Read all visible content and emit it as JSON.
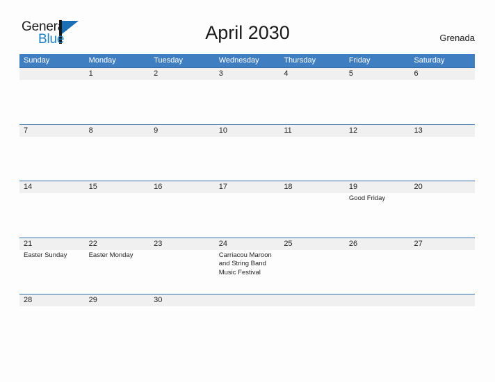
{
  "brand": {
    "name_part1": "General",
    "name_part2": "Blue",
    "mark": "flag-triangle-icon",
    "accent_color": "#1d7fc4"
  },
  "header": {
    "title": "April 2030",
    "location": "Grenada"
  },
  "colors": {
    "header_blue": "#3f7fc1",
    "row_line_blue": "#2f6ca8",
    "band_gray": "#f0f0f0",
    "page_bg": "#fdfdfd",
    "text": "#232323"
  },
  "calendar": {
    "weekdays": [
      "Sunday",
      "Monday",
      "Tuesday",
      "Wednesday",
      "Thursday",
      "Friday",
      "Saturday"
    ],
    "weeks": [
      [
        {
          "date": "",
          "event": ""
        },
        {
          "date": "1",
          "event": ""
        },
        {
          "date": "2",
          "event": ""
        },
        {
          "date": "3",
          "event": ""
        },
        {
          "date": "4",
          "event": ""
        },
        {
          "date": "5",
          "event": ""
        },
        {
          "date": "6",
          "event": ""
        }
      ],
      [
        {
          "date": "7",
          "event": ""
        },
        {
          "date": "8",
          "event": ""
        },
        {
          "date": "9",
          "event": ""
        },
        {
          "date": "10",
          "event": ""
        },
        {
          "date": "11",
          "event": ""
        },
        {
          "date": "12",
          "event": ""
        },
        {
          "date": "13",
          "event": ""
        }
      ],
      [
        {
          "date": "14",
          "event": ""
        },
        {
          "date": "15",
          "event": ""
        },
        {
          "date": "16",
          "event": ""
        },
        {
          "date": "17",
          "event": ""
        },
        {
          "date": "18",
          "event": ""
        },
        {
          "date": "19",
          "event": "Good Friday"
        },
        {
          "date": "20",
          "event": ""
        }
      ],
      [
        {
          "date": "21",
          "event": "Easter Sunday"
        },
        {
          "date": "22",
          "event": "Easter Monday"
        },
        {
          "date": "23",
          "event": ""
        },
        {
          "date": "24",
          "event": "Carriacou Maroon and String Band Music Festival"
        },
        {
          "date": "25",
          "event": ""
        },
        {
          "date": "26",
          "event": ""
        },
        {
          "date": "27",
          "event": ""
        }
      ],
      [
        {
          "date": "28",
          "event": ""
        },
        {
          "date": "29",
          "event": ""
        },
        {
          "date": "30",
          "event": ""
        },
        {
          "date": "",
          "event": ""
        },
        {
          "date": "",
          "event": ""
        },
        {
          "date": "",
          "event": ""
        },
        {
          "date": "",
          "event": ""
        }
      ]
    ]
  }
}
